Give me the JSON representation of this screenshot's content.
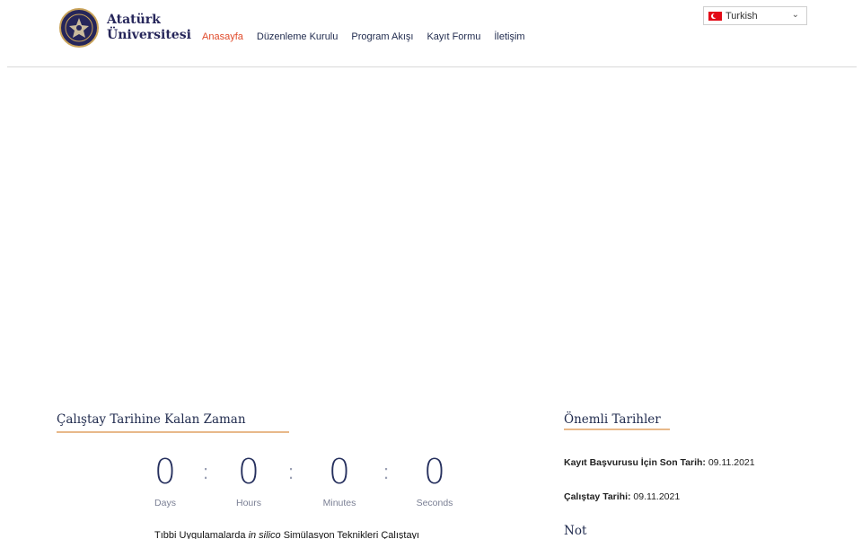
{
  "header": {
    "brand_line1": "Atatürk",
    "brand_line2": "Üniversitesi",
    "nav": [
      {
        "label": "Anasayfa",
        "active": true
      },
      {
        "label": "Düzenleme Kurulu"
      },
      {
        "label": "Program Akışı"
      },
      {
        "label": "Kayıt Formu"
      },
      {
        "label": "İletişim"
      }
    ],
    "language": {
      "selected": "Turkish"
    }
  },
  "countdown": {
    "title": "Çalıştay Tarihine Kalan Zaman",
    "units": [
      {
        "value": "0",
        "label": "Days"
      },
      {
        "value": "0",
        "label": "Hours"
      },
      {
        "value": "0",
        "label": "Minutes"
      },
      {
        "value": "0",
        "label": "Seconds"
      }
    ],
    "subtitle_pre": "Tıbbi Uygulamalarda",
    "subtitle_em": "in silico",
    "subtitle_post": "Simülasyon Teknikleri Çalıştayı"
  },
  "important_dates": {
    "title": "Önemli Tarihler",
    "rows": [
      {
        "label": "Kayıt Başvurusu İçin Son Tarih:",
        "value": "09.11.2021"
      },
      {
        "label": "Çalıştay Tarihi:",
        "value": "09.11.2021"
      }
    ],
    "note_title": "Not"
  },
  "colors": {
    "accent": "#e04a2a",
    "navy": "#26265a",
    "underline": "#e8b98a"
  }
}
